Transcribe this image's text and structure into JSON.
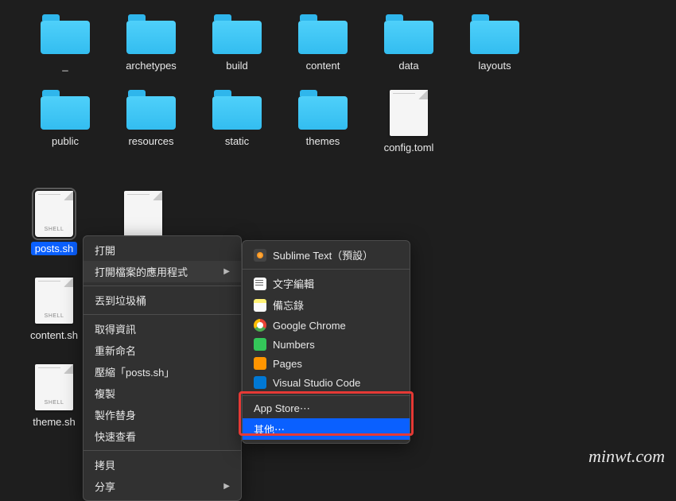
{
  "folders_row1": [
    {
      "label": "_"
    },
    {
      "label": "archetypes"
    },
    {
      "label": "build"
    },
    {
      "label": "content"
    },
    {
      "label": "data"
    },
    {
      "label": "layouts"
    }
  ],
  "folders_row2": [
    {
      "label": "public"
    },
    {
      "label": "resources"
    },
    {
      "label": "static"
    },
    {
      "label": "themes"
    }
  ],
  "file_row2": {
    "label": "config.toml"
  },
  "shell_files": [
    {
      "label": "posts.sh",
      "selected": true
    },
    {
      "label": "content.sh"
    },
    {
      "label": "theme.sh"
    }
  ],
  "shell_tag": "SHELL",
  "extra_file": {
    "label": ""
  },
  "ctx": {
    "open": "打開",
    "openwith": "打開檔案的應用程式",
    "trash": "丟到垃圾桶",
    "info": "取得資訊",
    "rename": "重新命名",
    "compress": "壓縮「posts.sh」",
    "dup": "複製",
    "alias": "製作替身",
    "quicklook": "快速查看",
    "copy": "拷貝",
    "share": "分享"
  },
  "sub": {
    "sublime": "Sublime Text（預設）",
    "textedit": "文字編輯",
    "notes": "備忘錄",
    "chrome": "Google Chrome",
    "numbers": "Numbers",
    "pages": "Pages",
    "vscode": "Visual Studio Code",
    "appstore": "App Store⋯",
    "other": "其他⋯"
  },
  "watermark": "minwt.com"
}
